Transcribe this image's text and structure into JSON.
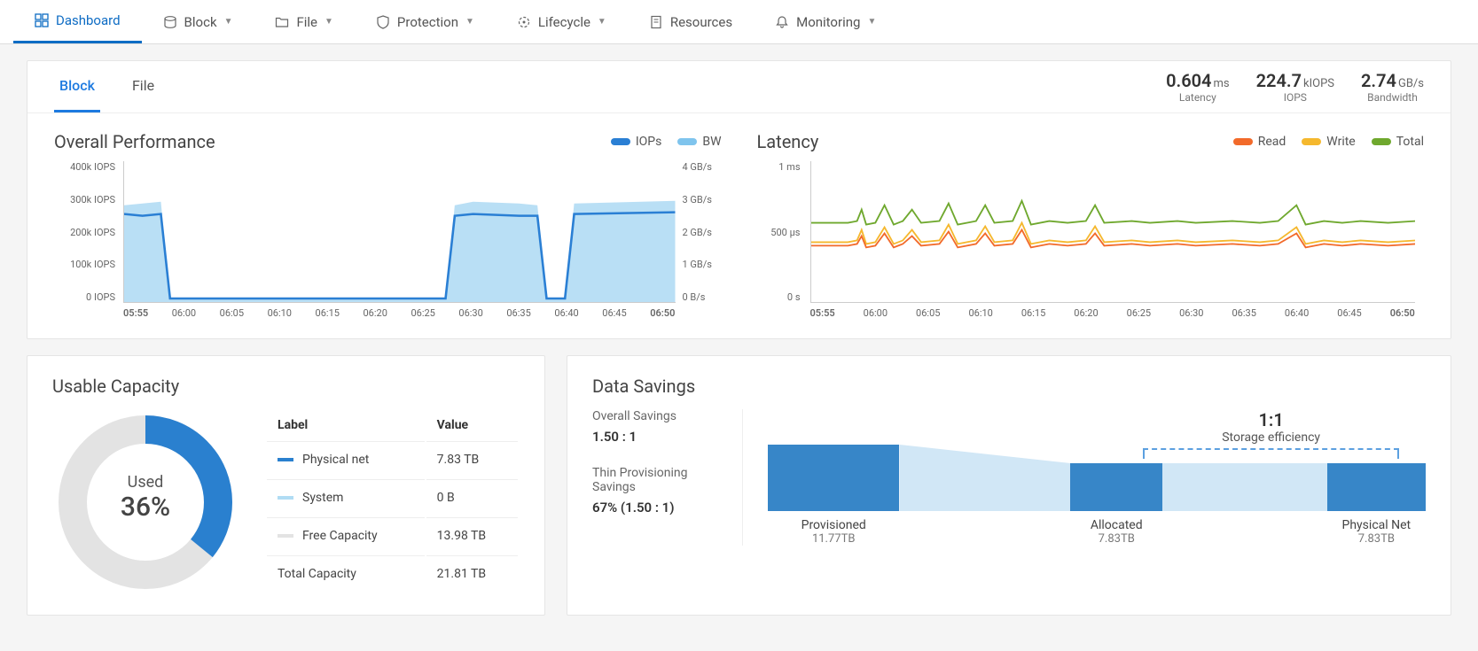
{
  "nav": {
    "items": [
      {
        "label": "Dashboard",
        "dropdown": false,
        "active": true
      },
      {
        "label": "Block",
        "dropdown": true
      },
      {
        "label": "File",
        "dropdown": true
      },
      {
        "label": "Protection",
        "dropdown": true
      },
      {
        "label": "Lifecycle",
        "dropdown": true
      },
      {
        "label": "Resources",
        "dropdown": false
      },
      {
        "label": "Monitoring",
        "dropdown": true
      }
    ]
  },
  "subtabs": [
    {
      "label": "Block",
      "active": true
    },
    {
      "label": "File",
      "active": false
    }
  ],
  "summary": {
    "latency": {
      "value": "0.604",
      "unit": "ms",
      "label": "Latency"
    },
    "iops": {
      "value": "224.7",
      "unit": "kIOPS",
      "label": "IOPS"
    },
    "bandwidth": {
      "value": "2.74",
      "unit": "GB/s",
      "label": "Bandwidth"
    }
  },
  "perf": {
    "title": "Overall Performance",
    "legend": [
      {
        "label": "IOPs",
        "color": "#2a7fd4"
      },
      {
        "label": "BW",
        "color": "#7fc4ed"
      }
    ],
    "yleft": [
      "400k IOPS",
      "300k IOPS",
      "200k IOPS",
      "100k IOPS",
      "0 IOPS"
    ],
    "yright": [
      "4 GB/s",
      "3 GB/s",
      "2 GB/s",
      "1 GB/s",
      "0 B/s"
    ],
    "xaxis": [
      "05:55",
      "06:00",
      "06:05",
      "06:10",
      "06:15",
      "06:20",
      "06:25",
      "06:30",
      "06:35",
      "06:40",
      "06:45",
      "06:50"
    ]
  },
  "lat": {
    "title": "Latency",
    "legend": [
      {
        "label": "Read",
        "color": "#f26a2a"
      },
      {
        "label": "Write",
        "color": "#f5b82e"
      },
      {
        "label": "Total",
        "color": "#6fa82e"
      }
    ],
    "yaxis": [
      "1 ms",
      "500 µs",
      "0 s"
    ],
    "xaxis": [
      "05:55",
      "06:00",
      "06:05",
      "06:10",
      "06:15",
      "06:20",
      "06:25",
      "06:30",
      "06:35",
      "06:40",
      "06:45",
      "06:50"
    ]
  },
  "capacity": {
    "title": "Usable Capacity",
    "used_label": "Used",
    "used_pct": "36%",
    "headers": [
      "Label",
      "Value"
    ],
    "rows": [
      {
        "swatch": "#2a80cf",
        "label": "Physical net",
        "value": "7.83 TB"
      },
      {
        "swatch": "#b0dcf4",
        "label": "System",
        "value": "0 B"
      },
      {
        "swatch": "#e3e3e3",
        "label": "Free Capacity",
        "value": "13.98 TB"
      },
      {
        "swatch": "",
        "label": "Total Capacity",
        "value": "21.81 TB"
      }
    ]
  },
  "savings": {
    "title": "Data Savings",
    "overall": {
      "label": "Overall Savings",
      "value": "1.50 : 1"
    },
    "thin": {
      "label": "Thin Provisioning Savings",
      "value": "67% (1.50 : 1)"
    },
    "efficiency": {
      "ratio": "1:1",
      "label": "Storage efficiency"
    },
    "bars": [
      {
        "name": "Provisioned",
        "value": "11.77TB"
      },
      {
        "name": "Allocated",
        "value": "7.83TB"
      },
      {
        "name": "Physical Net",
        "value": "7.83TB"
      }
    ]
  },
  "chart_data": [
    {
      "type": "line",
      "title": "Overall Performance",
      "x": [
        "05:55",
        "06:00",
        "06:05",
        "06:10",
        "06:15",
        "06:20",
        "06:25",
        "06:30",
        "06:35",
        "06:40",
        "06:45",
        "06:50"
      ],
      "series": [
        {
          "name": "IOPs",
          "unit": "kIOPS",
          "values": [
            250,
            240,
            5,
            5,
            5,
            5,
            5,
            5,
            230,
            230,
            225,
            230,
            5,
            240,
            250
          ]
        },
        {
          "name": "BW",
          "unit": "GB/s",
          "values": [
            2.7,
            2.6,
            0.05,
            0.05,
            0.05,
            0.05,
            0.05,
            0.05,
            2.6,
            2.6,
            2.55,
            2.6,
            0.05,
            2.7,
            2.7
          ]
        }
      ],
      "yleft": {
        "label": "IOPS",
        "range": [
          0,
          400000
        ]
      },
      "yright": {
        "label": "GB/s",
        "range": [
          0,
          4
        ]
      }
    },
    {
      "type": "line",
      "title": "Latency",
      "x": [
        "05:55",
        "06:00",
        "06:05",
        "06:10",
        "06:15",
        "06:20",
        "06:25",
        "06:30",
        "06:35",
        "06:40",
        "06:45",
        "06:50"
      ],
      "series": [
        {
          "name": "Read",
          "unit": "µs",
          "values": [
            420,
            420,
            430,
            410,
            430,
            420,
            430,
            420,
            420,
            430,
            420,
            420
          ]
        },
        {
          "name": "Write",
          "unit": "µs",
          "values": [
            440,
            445,
            450,
            440,
            450,
            445,
            450,
            445,
            445,
            450,
            460,
            445
          ]
        },
        {
          "name": "Total",
          "unit": "µs",
          "values": [
            560,
            560,
            570,
            555,
            575,
            560,
            570,
            560,
            560,
            570,
            580,
            565
          ]
        }
      ],
      "ylim": [
        0,
        1000
      ]
    },
    {
      "type": "pie",
      "title": "Usable Capacity",
      "categories": [
        "Physical net",
        "System",
        "Free Capacity"
      ],
      "values": [
        7.83,
        0,
        13.98
      ],
      "unit": "TB",
      "total": 21.81,
      "center_label": "Used 36%"
    },
    {
      "type": "bar",
      "title": "Data Savings",
      "categories": [
        "Provisioned",
        "Allocated",
        "Physical Net"
      ],
      "values": [
        11.77,
        7.83,
        7.83
      ],
      "unit": "TB"
    }
  ]
}
